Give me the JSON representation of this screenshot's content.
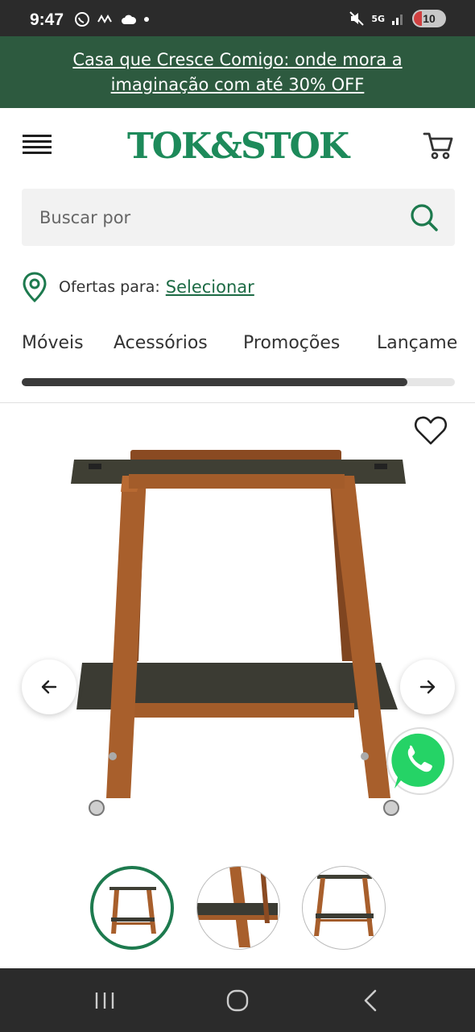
{
  "status_bar": {
    "time": "9:47",
    "battery": "10",
    "network": "5G"
  },
  "promo": {
    "text": "Casa que Cresce Comigo: onde mora a imaginação com até 30% OFF"
  },
  "header": {
    "logo": "TOK&STOK"
  },
  "search": {
    "placeholder": "Buscar por"
  },
  "location": {
    "label": "Ofertas para:",
    "link": "Selecionar"
  },
  "categories": {
    "items": [
      "Móveis",
      "Acessórios",
      "Promoções",
      "Lançame"
    ],
    "scroll_progress": 0.89
  },
  "colors": {
    "brand_green": "#1d8a5a",
    "promo_bg": "#2d5a3f",
    "whatsapp": "#25d366"
  },
  "gallery": {
    "thumbnail_count": 3,
    "active_thumbnail": 0
  }
}
